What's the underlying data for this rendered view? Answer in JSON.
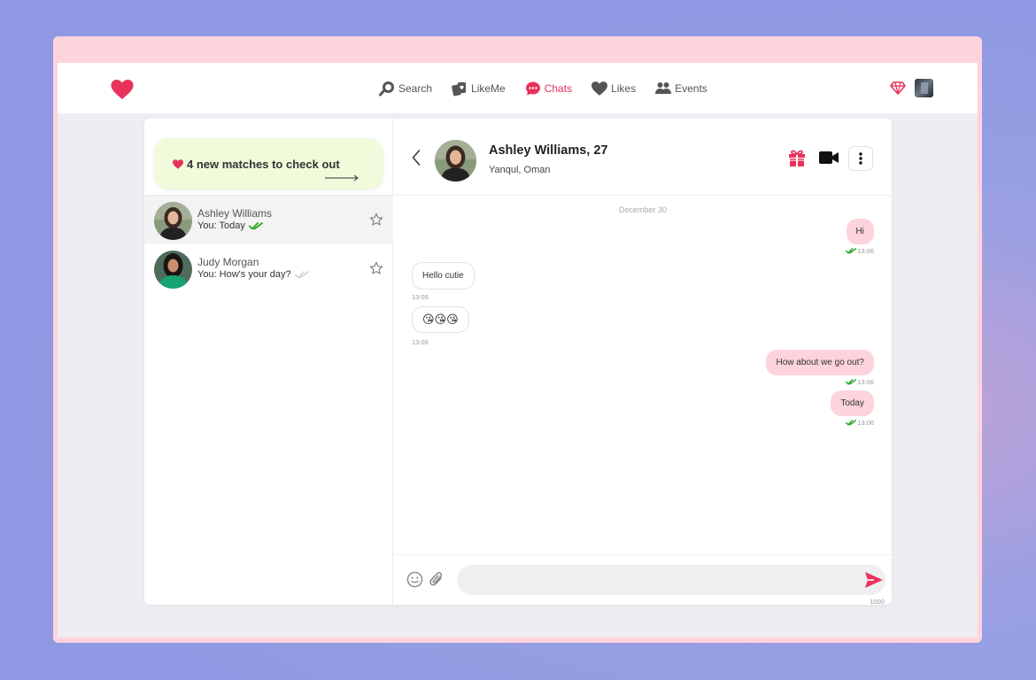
{
  "nav": {
    "items": [
      {
        "label": "Search",
        "icon": "search-icon",
        "active": false
      },
      {
        "label": "LikeMe",
        "icon": "cards-icon",
        "active": false
      },
      {
        "label": "Chats",
        "icon": "chat-bubble-icon",
        "active": true
      },
      {
        "label": "Likes",
        "icon": "heart-icon",
        "active": false
      },
      {
        "label": "Events",
        "icon": "people-icon",
        "active": false
      }
    ]
  },
  "colors": {
    "accent": "#e8325c",
    "bubble_out": "#fdd3dc",
    "promo_bg": "#f0fbdc",
    "read_check": "#2aa82a"
  },
  "promo": {
    "text": "4 new matches to check out"
  },
  "conversations": [
    {
      "name": "Ashley Williams",
      "preview": "You: Today",
      "read": true,
      "active": true
    },
    {
      "name": "Judy Morgan",
      "preview": "You: How's your day?",
      "read": false,
      "active": false
    }
  ],
  "chat": {
    "name": "Ashley Williams, 27",
    "location": "Yanqul, Oman",
    "date": "December 30",
    "messages": [
      {
        "dir": "out",
        "text": "Hi",
        "time": "13:06"
      },
      {
        "dir": "in",
        "text": "Hello cutie",
        "time": "13:06"
      },
      {
        "dir": "in",
        "text": "😘😘😘",
        "time": "13:06"
      },
      {
        "dir": "out",
        "text": "How about we go out?",
        "time": "13:06"
      },
      {
        "dir": "out",
        "text": "Today",
        "time": "13:06"
      }
    ],
    "input_value": "",
    "char_limit": "1000"
  }
}
